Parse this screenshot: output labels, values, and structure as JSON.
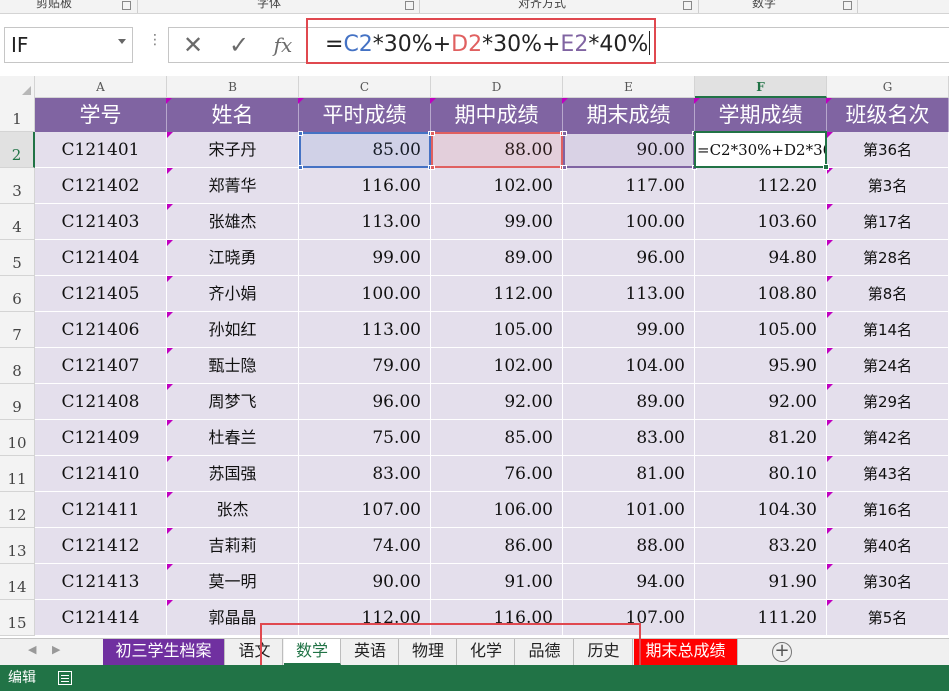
{
  "ribbon": {
    "groups": [
      "剪贴板",
      "字体",
      "对齐方式",
      "数字"
    ]
  },
  "formula_bar": {
    "name_box": "IF",
    "cancel_icon": "✕",
    "enter_icon": "✓",
    "fx_label": "fx",
    "formula_parts": [
      {
        "text": "=",
        "ref": ""
      },
      {
        "text": "C2",
        "ref": "c"
      },
      {
        "text": "*30%+",
        "ref": ""
      },
      {
        "text": "D2",
        "ref": "d"
      },
      {
        "text": "*30%+",
        "ref": ""
      },
      {
        "text": "E2",
        "ref": "e"
      },
      {
        "text": "*40%",
        "ref": ""
      }
    ]
  },
  "grid": {
    "columns": [
      "A",
      "B",
      "C",
      "D",
      "E",
      "F",
      "G"
    ],
    "selected_column": "F",
    "row_numbers": [
      "1",
      "2",
      "3",
      "4",
      "5",
      "6",
      "7",
      "8",
      "9",
      "10",
      "11",
      "12",
      "13",
      "14",
      "15"
    ],
    "selected_row": "2",
    "headers": [
      "学号",
      "姓名",
      "平时成绩",
      "期中成绩",
      "期末成绩",
      "学期成绩",
      "班级名次"
    ],
    "editing_cell_text": "=C2*30%+D2*30%+E2*40%",
    "rows": [
      [
        "C121401",
        "宋子丹",
        "85.00",
        "88.00",
        "90.00",
        "",
        "第36名"
      ],
      [
        "C121402",
        "郑菁华",
        "116.00",
        "102.00",
        "117.00",
        "112.20",
        "第3名"
      ],
      [
        "C121403",
        "张雄杰",
        "113.00",
        "99.00",
        "100.00",
        "103.60",
        "第17名"
      ],
      [
        "C121404",
        "江晓勇",
        "99.00",
        "89.00",
        "96.00",
        "94.80",
        "第28名"
      ],
      [
        "C121405",
        "齐小娟",
        "100.00",
        "112.00",
        "113.00",
        "108.80",
        "第8名"
      ],
      [
        "C121406",
        "孙如红",
        "113.00",
        "105.00",
        "99.00",
        "105.00",
        "第14名"
      ],
      [
        "C121407",
        "甄士隐",
        "79.00",
        "102.00",
        "104.00",
        "95.90",
        "第24名"
      ],
      [
        "C121408",
        "周梦飞",
        "96.00",
        "92.00",
        "89.00",
        "92.00",
        "第29名"
      ],
      [
        "C121409",
        "杜春兰",
        "75.00",
        "85.00",
        "83.00",
        "81.20",
        "第42名"
      ],
      [
        "C121410",
        "苏国强",
        "83.00",
        "76.00",
        "81.00",
        "80.10",
        "第43名"
      ],
      [
        "C121411",
        "张杰",
        "107.00",
        "106.00",
        "101.00",
        "104.30",
        "第16名"
      ],
      [
        "C121412",
        "吉莉莉",
        "74.00",
        "86.00",
        "88.00",
        "83.20",
        "第40名"
      ],
      [
        "C121413",
        "莫一明",
        "90.00",
        "91.00",
        "94.00",
        "91.90",
        "第30名"
      ],
      [
        "C121414",
        "郭晶晶",
        "112.00",
        "116.00",
        "107.00",
        "111.20",
        "第5名"
      ]
    ]
  },
  "sheet_tabs": [
    {
      "label": "初三学生档案",
      "style": "purple"
    },
    {
      "label": "语文",
      "style": "normal"
    },
    {
      "label": "数学",
      "style": "active"
    },
    {
      "label": "英语",
      "style": "normal"
    },
    {
      "label": "物理",
      "style": "normal"
    },
    {
      "label": "化学",
      "style": "normal"
    },
    {
      "label": "品德",
      "style": "normal"
    },
    {
      "label": "历史",
      "style": "normal"
    },
    {
      "label": "期末总成绩",
      "style": "red"
    }
  ],
  "add_sheet": "+",
  "status": {
    "mode": "编辑"
  },
  "colors": {
    "header_purple": "#8064a2",
    "cell_lavender": "#e4dfec",
    "excel_green": "#217346",
    "highlight_red": "#e0484f",
    "ref_blue": "#4472c4",
    "ref_red": "#e06060",
    "ref_purple": "#8064a2"
  }
}
